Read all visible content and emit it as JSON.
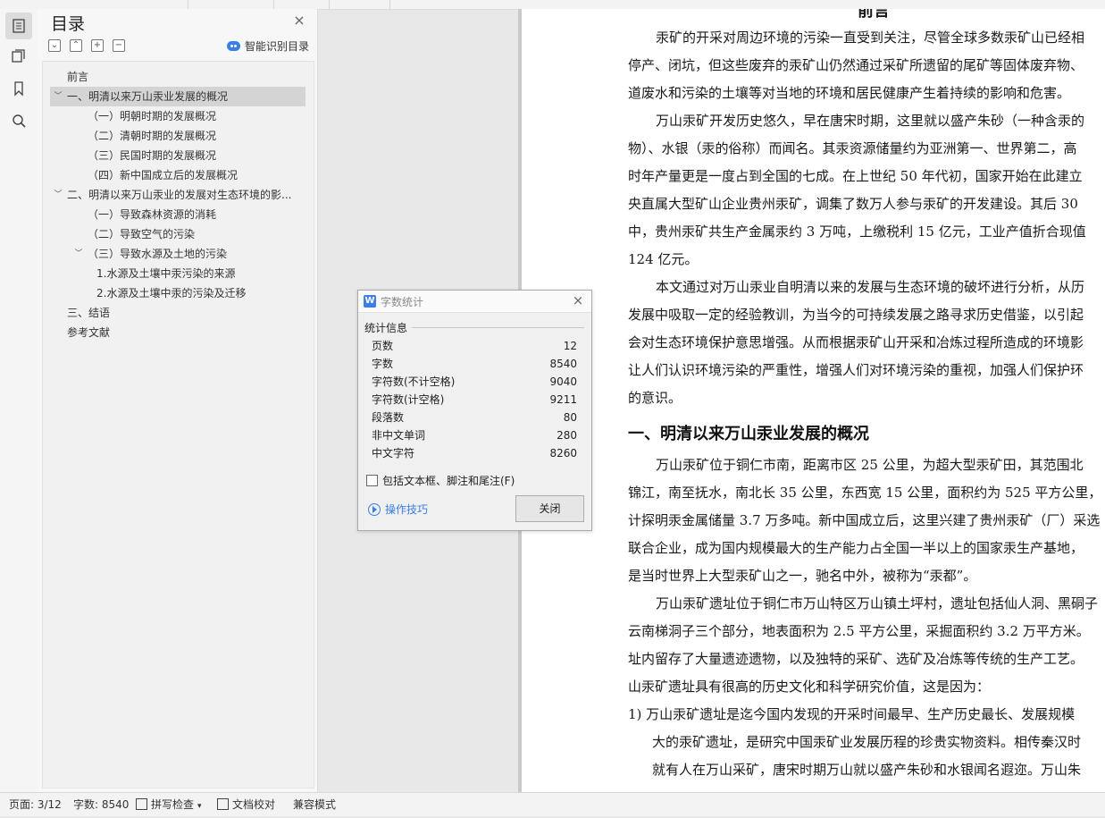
{
  "toc": {
    "title": "目录",
    "smart_label": "智能识别目录",
    "tools": [
      "collapse",
      "expand",
      "add",
      "remove"
    ],
    "items": [
      {
        "label": "前言",
        "level": 0,
        "caret": ""
      },
      {
        "label": "一、明清以来万山汞业发展的概况",
        "level": 0,
        "caret": "v",
        "selected": true
      },
      {
        "label": "（一）明朝时期的发展概况",
        "level": 1,
        "caret": ""
      },
      {
        "label": "（二）清朝时期的发展概况",
        "level": 1,
        "caret": ""
      },
      {
        "label": "（三）民国时期的发展概况",
        "level": 1,
        "caret": ""
      },
      {
        "label": "（四）新中国成立后的发展概况",
        "level": 1,
        "caret": ""
      },
      {
        "label": "二、明清以来万山汞业的发展对生态环境的影...",
        "level": 0,
        "caret": "v"
      },
      {
        "label": "（一）导致森林资源的消耗",
        "level": 1,
        "caret": ""
      },
      {
        "label": "（二）导致空气的污染",
        "level": 1,
        "caret": ""
      },
      {
        "label": "（三）导致水源及土地的污染",
        "level": 1,
        "caret": "v"
      },
      {
        "label": "1.水源及土壤中汞污染的来源",
        "level": 2,
        "caret": ""
      },
      {
        "label": "2.水源及土壤中汞的污染及迁移",
        "level": 2,
        "caret": ""
      },
      {
        "label": "三、结语",
        "level": 0,
        "caret": ""
      },
      {
        "label": "参考文献",
        "level": 0,
        "caret": ""
      }
    ]
  },
  "document": {
    "top_partial": "前言",
    "lines": [
      {
        "text": "汞矿的开采对周边环境的污染一直受到关注，尽管全球多数汞矿山已经相",
        "indent": true
      },
      {
        "text": "停产、闭坑，但这些废弃的汞矿山仍然通过采矿所遗留的尾矿等固体废弃物、",
        "indent": false
      },
      {
        "text": "道废水和污染的土壤等对当地的环境和居民健康产生着持续的影响和危害。",
        "indent": false
      },
      {
        "text": "万山汞矿开发历史悠久，早在唐宋时期，这里就以盛产朱砂（一种含汞的",
        "indent": true
      },
      {
        "text": "物）、水银（汞的俗称）而闻名。其汞资源储量约为亚洲第一、世界第二，高",
        "indent": false
      },
      {
        "text": "时年产量更是一度占到全国的七成。在上世纪 50 年代初，国家开始在此建立",
        "indent": false
      },
      {
        "text": "央直属大型矿山企业贵州汞矿，调集了数万人参与汞矿的开发建设。其后 30",
        "indent": false
      },
      {
        "text": "中，贵州汞矿共生产金属汞约 3 万吨，上缴税利 15 亿元，工业产值折合现值",
        "indent": false
      },
      {
        "text": "124 亿元。",
        "indent": false
      },
      {
        "text": "本文通过对万山汞业自明清以来的发展与生态环境的破坏进行分析，从历",
        "indent": true
      },
      {
        "text": "发展中吸取一定的经验教训，为当今的可持续发展之路寻求历史借鉴，以引起",
        "indent": false
      },
      {
        "text": "会对生态环境保护意思增强。从而根据汞矿山开采和冶炼过程所造成的环境影",
        "indent": false
      },
      {
        "text": "让人们认识环境污染的严重性，增强人们对环境污染的重视，加强人们保护环",
        "indent": false
      },
      {
        "text": "的意识。",
        "indent": false
      }
    ],
    "heading": "一、明清以来万山汞业发展的概况",
    "lines2": [
      {
        "text": "万山汞矿位于铜仁市南，距离市区 25 公里，为超大型汞矿田，其范围北",
        "indent": true
      },
      {
        "text": "锦江，南至抚水，南北长 35 公里，东西宽 15 公里，面积约为 525 平方公里，",
        "indent": false
      },
      {
        "text": "计探明汞金属储量 3.7 万多吨。新中国成立后，这里兴建了贵州汞矿（厂）采选",
        "indent": false
      },
      {
        "text": "联合企业，成为国内规模最大的生产能力占全国一半以上的国家汞生产基地，",
        "indent": false
      },
      {
        "text": "是当时世界上大型汞矿山之一，驰名中外，被称为“汞都”。",
        "indent": false
      },
      {
        "text": "万山汞矿遗址位于铜仁市万山特区万山镇土坪村，遗址包括仙人洞、黑硐子",
        "indent": true
      },
      {
        "text": "云南梯洞子三个部分，地表面积为 2.5 平方公里，采掘面积约 3.2 万平方米。",
        "indent": false
      },
      {
        "text": "址内留存了大量遗迹遗物，以及独特的采矿、选矿及冶炼等传统的生产工艺。",
        "indent": false
      },
      {
        "text": "山汞矿遗址具有很高的历史文化和科学研究价值，这是因为：",
        "indent": false
      },
      {
        "text": "1)  万山汞矿遗址是迄今国内发现的开采时间最早、生产历史最长、发展规模",
        "indent": false,
        "list": true
      },
      {
        "text": "大的汞矿遗址，是研究中国汞矿业发展历程的珍贵实物资料。相传秦汉时",
        "indent": false,
        "sub": true
      },
      {
        "text": "就有人在万山采矿，唐宋时期万山就以盛产朱砂和水银闻名遐迩。万山朱",
        "indent": false,
        "sub": true
      }
    ]
  },
  "dialog": {
    "title": "字数统计",
    "logo": "W",
    "section": "统计信息",
    "stats": [
      {
        "label": "页数",
        "value": "12"
      },
      {
        "label": "字数",
        "value": "8540"
      },
      {
        "label": "字符数(不计空格)",
        "value": "9040"
      },
      {
        "label": "字符数(计空格)",
        "value": "9211"
      },
      {
        "label": "段落数",
        "value": "80"
      },
      {
        "label": "非中文单词",
        "value": "280"
      },
      {
        "label": "中文字符",
        "value": "8260"
      }
    ],
    "checkbox_label": "包括文本框、脚注和尾注(F)",
    "tips_label": "操作技巧",
    "close_label": "关闭"
  },
  "status": {
    "page": "页面: 3/12",
    "words": "字数: 8540",
    "spell": "拼写检查",
    "proof": "文档校对",
    "compat": "兼容模式"
  }
}
